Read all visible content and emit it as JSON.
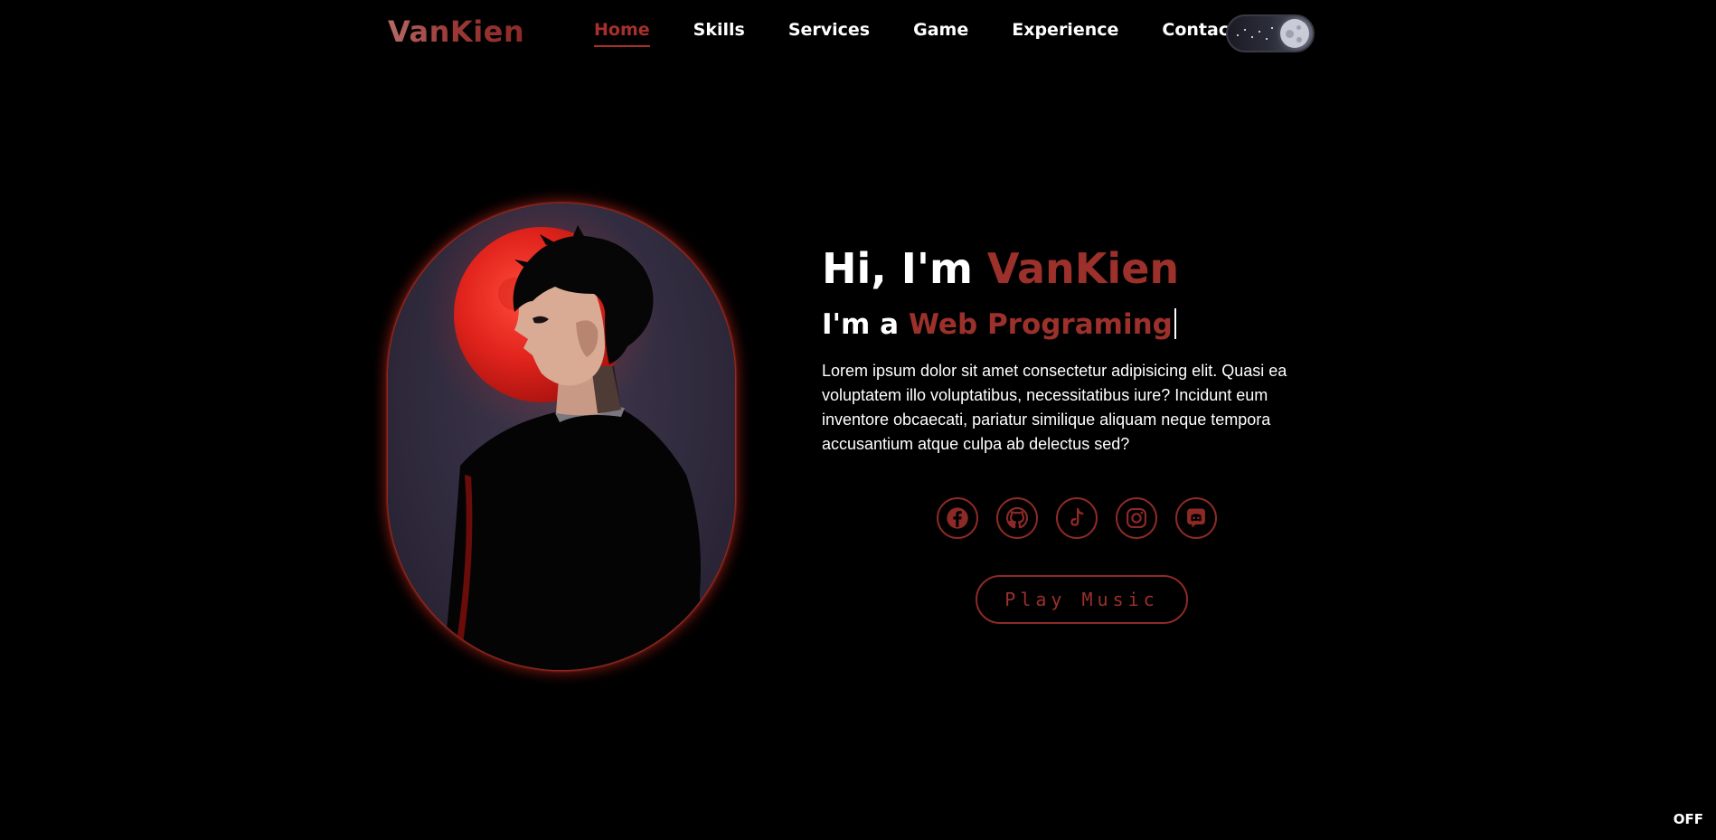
{
  "header": {
    "logo": "VanKien",
    "nav": [
      {
        "label": "Home",
        "active": true
      },
      {
        "label": "Skills"
      },
      {
        "label": "Services"
      },
      {
        "label": "Game"
      },
      {
        "label": "Experience"
      },
      {
        "label": "Contact"
      }
    ],
    "theme_toggle": {
      "icon": "moon-icon",
      "state": "dark"
    }
  },
  "hero": {
    "greeting_prefix": "Hi, I'm ",
    "greeting_name": "VanKien",
    "role_prefix": "I'm a ",
    "role": "Web Programing",
    "description": "Lorem ipsum dolor sit amet consectetur adipisicing elit. Quasi ea voluptatem illo voluptatibus, necessitatibus iure? Incidunt eum inventore obcaecati, pariatur similique aliquam neque tempora accusantium atque culpa ab delectus sed?",
    "socials": [
      {
        "icon": "facebook-icon"
      },
      {
        "icon": "github-icon"
      },
      {
        "icon": "tiktok-icon"
      },
      {
        "icon": "instagram-icon"
      },
      {
        "icon": "discord-icon"
      }
    ],
    "play_button": "Play Music"
  },
  "music_status": "OFF",
  "colors": {
    "accent": "#9c302b",
    "background": "#000000",
    "text": "#ffffff"
  }
}
